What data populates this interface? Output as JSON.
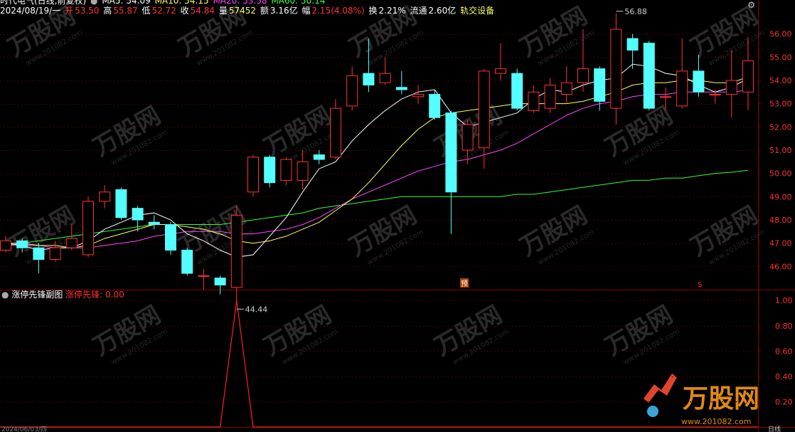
{
  "header": {
    "stock_name": "时代电气(日线,前复权)",
    "ma_labels": [
      {
        "text": "MA5: 54.09",
        "color": "#ffffff"
      },
      {
        "text": "MA10: 54.15",
        "color": "#ffff66"
      },
      {
        "text": "MA20: 53.58",
        "color": "#ff44ff"
      },
      {
        "text": "MA60: 50.14",
        "color": "#44ff44"
      }
    ],
    "date": "2024/08/19/一",
    "open_label": "开",
    "open": "53.50",
    "high_label": "高",
    "high": "55.87",
    "low_label": "低",
    "low": "52.72",
    "close_label": "收",
    "close": "54.84",
    "vol_label": "量",
    "vol": "57452",
    "amt_label": "额",
    "amt": "3.16亿",
    "chg_label": "幅",
    "chg": "2.15(4.08%)",
    "turnover_label": "换",
    "turnover": "2.21%",
    "float_label": "流通",
    "float": "2.60亿",
    "sector": "轨交设备"
  },
  "sub_panel": {
    "title": "涨停先锋副图",
    "indicator": "涨停先锋: 0.00"
  },
  "markers": {
    "low_label": "44.44",
    "high_label": "56.88",
    "pre_tag": "预",
    "s_tag": "S"
  },
  "footer": {
    "bottom_date": "2024/06/03/四",
    "bottom_right": "日线"
  },
  "watermark": {
    "text": "万股网",
    "url": "www.201082.com"
  },
  "colors": {
    "up": "#ff3232",
    "down": "#54ffff",
    "grid": "#8b0000",
    "ma5": "#ffffff",
    "ma10": "#ffff66",
    "ma20": "#ff44ff",
    "ma60": "#33ff33"
  },
  "chart_data": [
    {
      "type": "candlestick",
      "title": "时代电气(日线,前复权)",
      "ylim": [
        45.0,
        56.6
      ],
      "yticks": [
        "56.00",
        "55.00",
        "54.00",
        "53.00",
        "52.00",
        "51.00",
        "50.00",
        "49.00",
        "48.00",
        "47.00",
        "46.00"
      ],
      "candles": [
        {
          "o": 46.7,
          "c": 47.1,
          "h": 47.3,
          "l": 46.6
        },
        {
          "o": 47.1,
          "c": 46.8,
          "h": 47.2,
          "l": 46.6
        },
        {
          "o": 46.8,
          "c": 46.3,
          "h": 47.0,
          "l": 45.7
        },
        {
          "o": 46.3,
          "c": 46.8,
          "h": 47.1,
          "l": 46.2
        },
        {
          "o": 46.8,
          "c": 47.2,
          "h": 47.8,
          "l": 46.7
        },
        {
          "o": 46.5,
          "c": 48.8,
          "h": 49.0,
          "l": 46.4
        },
        {
          "o": 48.8,
          "c": 49.2,
          "h": 49.5,
          "l": 48.5
        },
        {
          "o": 49.3,
          "c": 48.1,
          "h": 49.4,
          "l": 48.0
        },
        {
          "o": 48.5,
          "c": 48.0,
          "h": 48.6,
          "l": 47.5
        },
        {
          "o": 47.9,
          "c": 47.8,
          "h": 48.2,
          "l": 47.6
        },
        {
          "o": 47.8,
          "c": 46.7,
          "h": 47.9,
          "l": 46.5
        },
        {
          "o": 46.7,
          "c": 45.7,
          "h": 46.8,
          "l": 45.6
        },
        {
          "o": 45.6,
          "c": 45.6,
          "h": 45.9,
          "l": 45.0
        },
        {
          "o": 45.5,
          "c": 45.2,
          "h": 45.6,
          "l": 44.8
        },
        {
          "o": 45.1,
          "c": 48.2,
          "h": 48.6,
          "l": 44.44
        },
        {
          "o": 49.2,
          "c": 50.7,
          "h": 50.8,
          "l": 49.0
        },
        {
          "o": 50.7,
          "c": 49.6,
          "h": 50.8,
          "l": 49.4
        },
        {
          "o": 49.7,
          "c": 50.6,
          "h": 50.7,
          "l": 49.5
        },
        {
          "o": 49.7,
          "c": 50.5,
          "h": 51.0,
          "l": 49.3
        },
        {
          "o": 50.8,
          "c": 50.6,
          "h": 51.0,
          "l": 50.4
        },
        {
          "o": 50.7,
          "c": 52.8,
          "h": 53.2,
          "l": 50.6
        },
        {
          "o": 52.9,
          "c": 54.2,
          "h": 54.6,
          "l": 52.7
        },
        {
          "o": 54.3,
          "c": 53.8,
          "h": 55.8,
          "l": 53.5
        },
        {
          "o": 53.9,
          "c": 54.3,
          "h": 55.0,
          "l": 53.8
        },
        {
          "o": 53.7,
          "c": 53.6,
          "h": 54.4,
          "l": 53.4
        },
        {
          "o": 53.3,
          "c": 53.4,
          "h": 53.8,
          "l": 53.0
        },
        {
          "o": 53.4,
          "c": 52.4,
          "h": 53.6,
          "l": 52.3
        },
        {
          "o": 52.6,
          "c": 49.2,
          "h": 52.7,
          "l": 47.4
        },
        {
          "o": 51.0,
          "c": 52.1,
          "h": 52.3,
          "l": 50.4
        },
        {
          "o": 51.1,
          "c": 54.4,
          "h": 54.5,
          "l": 50.2
        },
        {
          "o": 54.3,
          "c": 54.5,
          "h": 55.6,
          "l": 54.0
        },
        {
          "o": 54.3,
          "c": 52.8,
          "h": 54.5,
          "l": 52.7
        },
        {
          "o": 52.7,
          "c": 53.5,
          "h": 53.8,
          "l": 52.6
        },
        {
          "o": 52.8,
          "c": 53.8,
          "h": 54.1,
          "l": 52.6
        },
        {
          "o": 53.4,
          "c": 53.9,
          "h": 54.6,
          "l": 53.0
        },
        {
          "o": 53.9,
          "c": 54.5,
          "h": 56.2,
          "l": 53.5
        },
        {
          "o": 54.5,
          "c": 53.1,
          "h": 54.6,
          "l": 52.7
        },
        {
          "o": 52.8,
          "c": 56.2,
          "h": 56.88,
          "l": 52.1
        },
        {
          "o": 55.8,
          "c": 55.3,
          "h": 56.0,
          "l": 54.5
        },
        {
          "o": 55.6,
          "c": 52.8,
          "h": 55.7,
          "l": 52.7
        },
        {
          "o": 53.3,
          "c": 53.3,
          "h": 53.7,
          "l": 52.7
        },
        {
          "o": 52.9,
          "c": 54.4,
          "h": 55.8,
          "l": 52.8
        },
        {
          "o": 54.4,
          "c": 53.5,
          "h": 55.1,
          "l": 53.3
        },
        {
          "o": 53.4,
          "c": 53.4,
          "h": 53.6,
          "l": 53.0
        },
        {
          "o": 53.4,
          "c": 54.0,
          "h": 55.3,
          "l": 52.4
        },
        {
          "o": 53.5,
          "c": 54.84,
          "h": 55.87,
          "l": 52.72
        }
      ],
      "ma5": [
        47.0,
        46.9,
        46.7,
        46.8,
        46.8,
        47.1,
        47.6,
        47.9,
        48.2,
        48.3,
        48.0,
        47.4,
        47.1,
        46.7,
        46.4,
        46.5,
        47.3,
        48.1,
        49.2,
        50.2,
        50.5,
        51.4,
        52.1,
        52.7,
        53.2,
        53.5,
        53.6,
        52.6,
        52.0,
        52.2,
        52.4,
        52.6,
        53.2,
        53.6,
        53.5,
        53.8,
        54.0,
        54.1,
        54.7,
        54.6,
        54.3,
        54.2,
        53.8,
        53.5,
        53.7,
        54.09
      ],
      "ma10": [
        47.0,
        47.0,
        46.9,
        46.9,
        46.8,
        46.9,
        47.2,
        47.4,
        47.6,
        47.8,
        47.8,
        47.7,
        47.6,
        47.4,
        47.1,
        47.0,
        47.1,
        47.3,
        47.6,
        47.9,
        48.4,
        48.9,
        49.6,
        50.4,
        51.2,
        51.9,
        52.4,
        52.6,
        52.7,
        52.8,
        52.9,
        53.0,
        53.0,
        53.0,
        53.0,
        53.1,
        53.3,
        53.5,
        53.8,
        53.9,
        53.9,
        54.0,
        54.0,
        53.9,
        53.9,
        54.15
      ],
      "ma20": [
        46.9,
        46.9,
        46.9,
        46.8,
        46.8,
        46.8,
        46.9,
        47.0,
        47.1,
        47.3,
        47.4,
        47.5,
        47.5,
        47.5,
        47.4,
        47.4,
        47.5,
        47.6,
        47.8,
        48.1,
        48.5,
        48.9,
        49.2,
        49.5,
        49.8,
        50.1,
        50.3,
        50.5,
        50.6,
        50.8,
        51.0,
        51.3,
        51.7,
        52.1,
        52.5,
        52.8,
        53.0,
        53.1,
        53.3,
        53.4,
        53.4,
        53.5,
        53.5,
        53.5,
        53.5,
        53.58
      ],
      "ma60": [
        46.9,
        47.0,
        47.1,
        47.2,
        47.3,
        47.4,
        47.5,
        47.6,
        47.7,
        47.8,
        47.8,
        47.8,
        47.8,
        47.8,
        47.9,
        48.0,
        48.1,
        48.2,
        48.3,
        48.5,
        48.6,
        48.7,
        48.8,
        48.9,
        49.0,
        49.0,
        49.0,
        49.0,
        49.0,
        49.0,
        49.0,
        49.1,
        49.1,
        49.2,
        49.3,
        49.4,
        49.5,
        49.6,
        49.7,
        49.7,
        49.8,
        49.8,
        49.9,
        50.0,
        50.05,
        50.14
      ]
    },
    {
      "type": "line",
      "title": "涨停先锋副图",
      "series": [
        {
          "name": "涨停先锋",
          "values": [
            0,
            0,
            0,
            0,
            0,
            0,
            0,
            0,
            0,
            0,
            0,
            0,
            0,
            0,
            1,
            0,
            0,
            0,
            0,
            0,
            0,
            0,
            0,
            0,
            0,
            0,
            0,
            0,
            0,
            0,
            0,
            0,
            0,
            0,
            0,
            0,
            0,
            0,
            0,
            0,
            0,
            0,
            0,
            0,
            0,
            0
          ]
        }
      ],
      "ylim": [
        0,
        1.08
      ],
      "yticks": [
        "1.00",
        "0.80",
        "0.60",
        "0.40",
        "0.20"
      ]
    }
  ]
}
